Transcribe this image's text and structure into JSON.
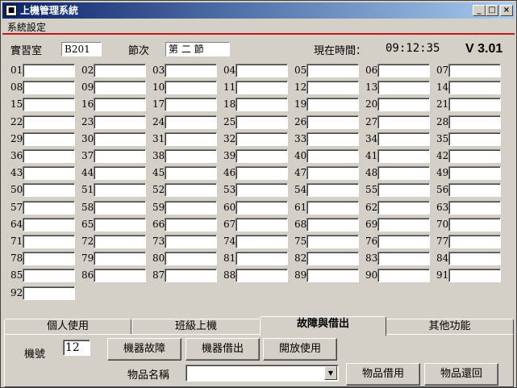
{
  "window": {
    "title": "上機管理系統",
    "minimize": "_",
    "maximize": "□",
    "close": "×"
  },
  "menu": {
    "settings": "系統設定"
  },
  "header": {
    "classroom_label": "實習室",
    "classroom_value": "B201",
    "period_label": "節次",
    "period_value": "第 二 節",
    "time_label": "現在時間：",
    "time_value": "09:12:35",
    "version": "V 3.01"
  },
  "machines": [
    "01",
    "02",
    "03",
    "04",
    "05",
    "06",
    "07",
    "08",
    "09",
    "10",
    "11",
    "12",
    "13",
    "14",
    "15",
    "16",
    "17",
    "18",
    "19",
    "20",
    "21",
    "22",
    "23",
    "24",
    "25",
    "26",
    "27",
    "28",
    "29",
    "30",
    "31",
    "32",
    "33",
    "34",
    "35",
    "36",
    "37",
    "38",
    "39",
    "40",
    "41",
    "42",
    "43",
    "44",
    "45",
    "46",
    "47",
    "48",
    "49",
    "50",
    "51",
    "52",
    "53",
    "54",
    "55",
    "56",
    "57",
    "58",
    "59",
    "60",
    "61",
    "62",
    "63",
    "64",
    "65",
    "66",
    "67",
    "68",
    "69",
    "70",
    "71",
    "72",
    "73",
    "74",
    "75",
    "76",
    "77",
    "78",
    "79",
    "80",
    "81",
    "82",
    "83",
    "84",
    "85",
    "86",
    "87",
    "88",
    "89",
    "90",
    "91",
    "92"
  ],
  "tabs": [
    "個人使用",
    "班級上機",
    "故障與借出",
    "其他功能"
  ],
  "active_tab": "故障與借出",
  "panel": {
    "machine_label": "機號",
    "machine_value": "12",
    "btn_fault": "機器故障",
    "btn_lend": "機器借出",
    "btn_open": "開放使用",
    "item_label": "物品名稱",
    "item_value": "",
    "btn_borrow": "物品借用",
    "btn_return": "物品還回"
  }
}
